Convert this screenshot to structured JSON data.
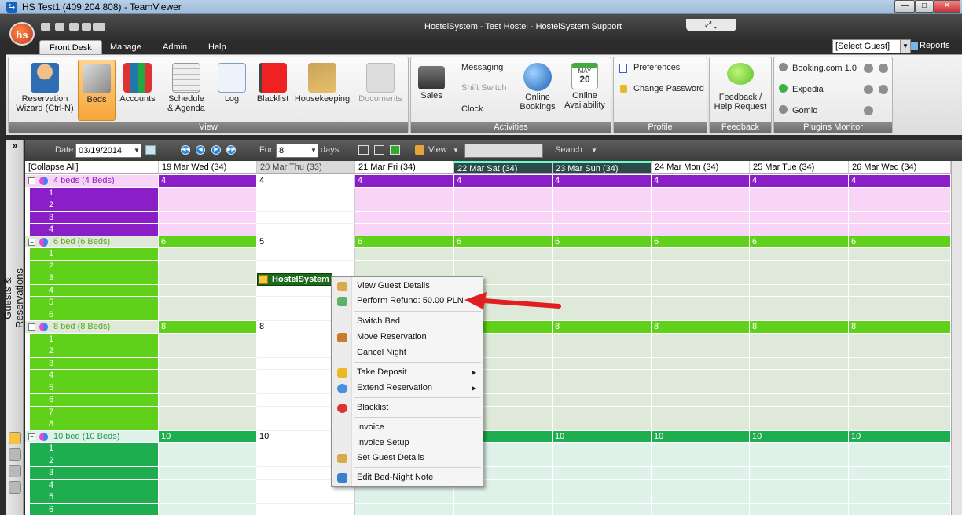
{
  "teamviewer": {
    "title": "HS Test1 (409 204 808) - TeamViewer"
  },
  "app": {
    "title": "HostelSystem - Test Hostel - HostelSystem Support",
    "logo": "hs"
  },
  "tabs": [
    {
      "label": "Front Desk"
    },
    {
      "label": "Manage"
    },
    {
      "label": "Admin"
    },
    {
      "label": "Help"
    }
  ],
  "guest_select": "[Select Guest]",
  "reports_label": "Reports",
  "ribbon": {
    "view": {
      "caption": "View",
      "buttons": [
        {
          "label1": "Reservation",
          "label2": "Wizard (Ctrl-N)"
        },
        {
          "label1": "Beds",
          "label2": ""
        },
        {
          "label1": "Accounts",
          "label2": ""
        },
        {
          "label1": "Schedule",
          "label2": "& Agenda"
        },
        {
          "label1": "Log",
          "label2": ""
        },
        {
          "label1": "Blacklist",
          "label2": ""
        },
        {
          "label1": "Housekeeping",
          "label2": ""
        },
        {
          "label1": "Documents",
          "label2": ""
        }
      ]
    },
    "activities": {
      "caption": "Activities",
      "sales": "Sales",
      "messaging": "Messaging",
      "shift_switch": "Shift Switch",
      "clock": "Clock",
      "online_bookings1": "Online",
      "online_bookings2": "Bookings",
      "online_avail1": "Online",
      "online_avail2": "Availability",
      "cal_month": "MAY",
      "cal_day": "20"
    },
    "profile": {
      "caption": "Profile",
      "preferences": "Preferences",
      "change_password": "Change Password"
    },
    "feedback": {
      "caption": "Feedback",
      "label1": "Feedback /",
      "label2": "Help Request"
    },
    "plugins": {
      "caption": "Plugins Monitor",
      "items": [
        "Booking.com 1.0",
        "Expedia",
        "Gomio"
      ]
    }
  },
  "sidebar": {
    "vertical_label": "Guests & Reservations",
    "collapse": "»"
  },
  "toolbar": {
    "date_label": "Date:",
    "date_value": "03/19/2014",
    "for_label": "For:",
    "for_value": "8",
    "days_label": "days",
    "view_label": "View",
    "search_label": "Search"
  },
  "grid": {
    "collapse_all": "[Collapse All]",
    "dates": [
      "19 Mar Wed (34)",
      "20 Mar Thu (33)",
      "21 Mar Fri (34)",
      "22 Mar Sat (34)",
      "23 Mar Sun (34)",
      "24 Mar Mon (34)",
      "25 Mar Tue (34)",
      "26 Mar Wed (34)"
    ],
    "groups": [
      {
        "name": "4 beds (4 Beds)",
        "counts": [
          "4",
          "4",
          "4",
          "4",
          "4",
          "4",
          "4",
          "4"
        ],
        "beds": [
          "1",
          "2",
          "3",
          "4"
        ]
      },
      {
        "name": "6 bed (6 Beds)",
        "counts": [
          "6",
          "5",
          "6",
          "6",
          "6",
          "6",
          "6",
          "6"
        ],
        "beds": [
          "1",
          "2",
          "3",
          "4",
          "5",
          "6"
        ]
      },
      {
        "name": "8 bed (8 Beds)",
        "counts": [
          "8",
          "8",
          "",
          "",
          "8",
          "8",
          "8",
          "8"
        ],
        "beds": [
          "1",
          "2",
          "3",
          "4",
          "5",
          "6",
          "7",
          "8"
        ]
      },
      {
        "name": "10 bed (10 Beds)",
        "counts": [
          "10",
          "10",
          "",
          "",
          "10",
          "10",
          "10",
          "10"
        ],
        "beds": [
          "1",
          "2",
          "3",
          "4",
          "5",
          "6"
        ]
      }
    ],
    "reservation_label": "HostelSystem"
  },
  "context_menu": {
    "items": [
      "View Guest Details",
      "Perform Refund: 50.00 PLN",
      "Switch Bed",
      "Move Reservation",
      "Cancel Night",
      "Take Deposit",
      "Extend Reservation",
      "Blacklist",
      "Invoice",
      "Invoice Setup",
      "Set Guest Details",
      "Edit Bed-Night Note"
    ],
    "submenu_glyph": "▶"
  },
  "colors": {
    "group1_dark": "#8b1fc7",
    "group1_light": "#f8d4f6",
    "group2_dark": "#5fd11a",
    "group2_light": "#dfe9da",
    "group4_dark": "#1fae4f",
    "group4_light": "#dff2ea",
    "arrow": "#e02020"
  }
}
